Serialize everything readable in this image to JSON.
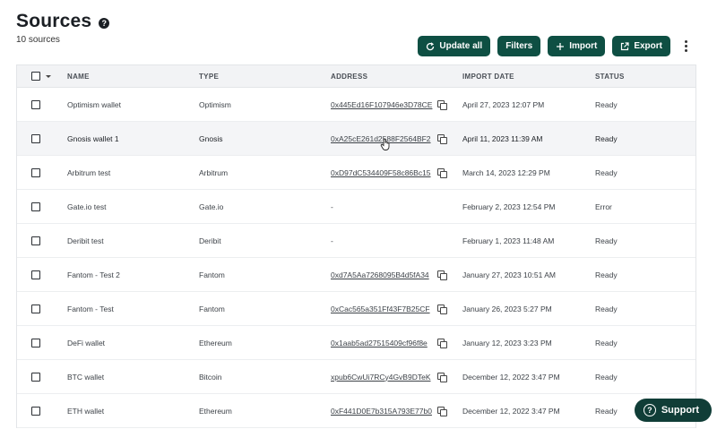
{
  "header": {
    "title": "Sources",
    "help": "?",
    "count": "10 sources"
  },
  "toolbar": {
    "update_all": "Update all",
    "filters": "Filters",
    "import": "Import",
    "export": "Export"
  },
  "table": {
    "columns": {
      "name": "NAME",
      "type": "TYPE",
      "address": "ADDRESS",
      "import_date": "IMPORT DATE",
      "status": "STATUS"
    },
    "rows": [
      {
        "name": "Optimism wallet",
        "type": "Optimism",
        "address": "0x445Ed16F107946e3D78CE",
        "date": "April 27, 2023 12:07 PM",
        "status": "Ready"
      },
      {
        "name": "Gnosis wallet 1",
        "type": "Gnosis",
        "address": "0xA25cE261d2588F2564BF2",
        "date": "April 11, 2023 11:39 AM",
        "status": "Ready"
      },
      {
        "name": "Arbitrum test",
        "type": "Arbitrum",
        "address": "0xD97dC534409F58c86Bc15",
        "date": "March 14, 2023 12:29 PM",
        "status": "Ready"
      },
      {
        "name": "Gate.io test",
        "type": "Gate.io",
        "address": "-",
        "date": "February 2, 2023 12:54 PM",
        "status": "Error"
      },
      {
        "name": "Deribit test",
        "type": "Deribit",
        "address": "-",
        "date": "February 1, 2023 11:48 AM",
        "status": "Ready"
      },
      {
        "name": "Fantom - Test 2",
        "type": "Fantom",
        "address": "0xd7A5Aa7268095B4d5fA34",
        "date": "January 27, 2023 10:51 AM",
        "status": "Ready"
      },
      {
        "name": "Fantom - Test",
        "type": "Fantom",
        "address": "0xCac565a351Ff43F7B25CF",
        "date": "January 26, 2023 5:27 PM",
        "status": "Ready"
      },
      {
        "name": "DeFi wallet",
        "type": "Ethereum",
        "address": "0x1aab5ad27515409cf96f8e",
        "date": "January 12, 2023 3:23 PM",
        "status": "Ready"
      },
      {
        "name": "BTC wallet",
        "type": "Bitcoin",
        "address": "xpub6CwUi7RCy4GvB9DTeK",
        "date": "December 12, 2022 3:47 PM",
        "status": "Ready"
      },
      {
        "name": "ETH wallet",
        "type": "Ethereum",
        "address": "0xF441D0E7b315A793E77b0",
        "date": "December 12, 2022 3:47 PM",
        "status": "Ready"
      }
    ]
  },
  "support": {
    "label": "Support",
    "icon": "?"
  },
  "colors": {
    "primary": "#0e4f43",
    "support": "#103d37"
  }
}
